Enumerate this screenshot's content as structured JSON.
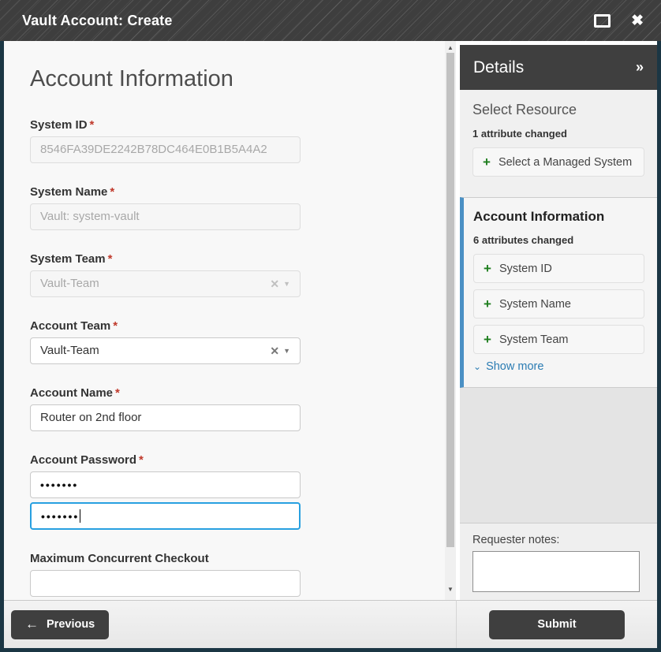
{
  "titlebar": {
    "title": "Vault Account: Create"
  },
  "icons": {
    "close": "✖",
    "clear": "✕",
    "caret_down": "▼",
    "chevron_double_right": "»",
    "chevron_down": "⌄",
    "plus": "+",
    "arrow_left": "←",
    "scroll_up": "▲",
    "scroll_down": "▼"
  },
  "form": {
    "heading": "Account Information",
    "required_marker": "*",
    "fields": {
      "system_id": {
        "label": "System ID",
        "value": "8546FA39DE2242B78DC464E0B1B5A4A2"
      },
      "system_name": {
        "label": "System Name",
        "value": "Vault: system-vault"
      },
      "system_team": {
        "label": "System Team",
        "value": "Vault-Team"
      },
      "account_team": {
        "label": "Account Team",
        "value": "Vault-Team"
      },
      "account_name": {
        "label": "Account Name",
        "value": "Router on 2nd floor"
      },
      "account_password": {
        "label": "Account Password",
        "masked_value": "•••••••",
        "confirm_masked_value": "•••••••"
      },
      "max_concurrent_checkout": {
        "label": "Maximum Concurrent Checkout",
        "value": ""
      }
    }
  },
  "details": {
    "header": "Details",
    "select_resource": {
      "heading": "Select Resource",
      "changed_note": "1 attribute changed",
      "button_label": "Select a Managed System"
    },
    "account_information": {
      "heading": "Account Information",
      "changed_note": "6 attributes changed",
      "attributes": [
        "System ID",
        "System Name",
        "System Team"
      ],
      "show_more_label": "Show more"
    },
    "requester_notes_label": "Requester notes:",
    "requester_notes_value": ""
  },
  "footer": {
    "previous_label": "Previous",
    "submit_label": "Submit"
  },
  "colors": {
    "window_border": "#1b3644",
    "titlebar_bg": "#3e3e3e",
    "accent_blue": "#4a90c4",
    "focus_blue": "#28a0e0",
    "green_plus": "#1e7e1e",
    "link_blue": "#2b7cb3",
    "required_red": "#c0392b"
  }
}
